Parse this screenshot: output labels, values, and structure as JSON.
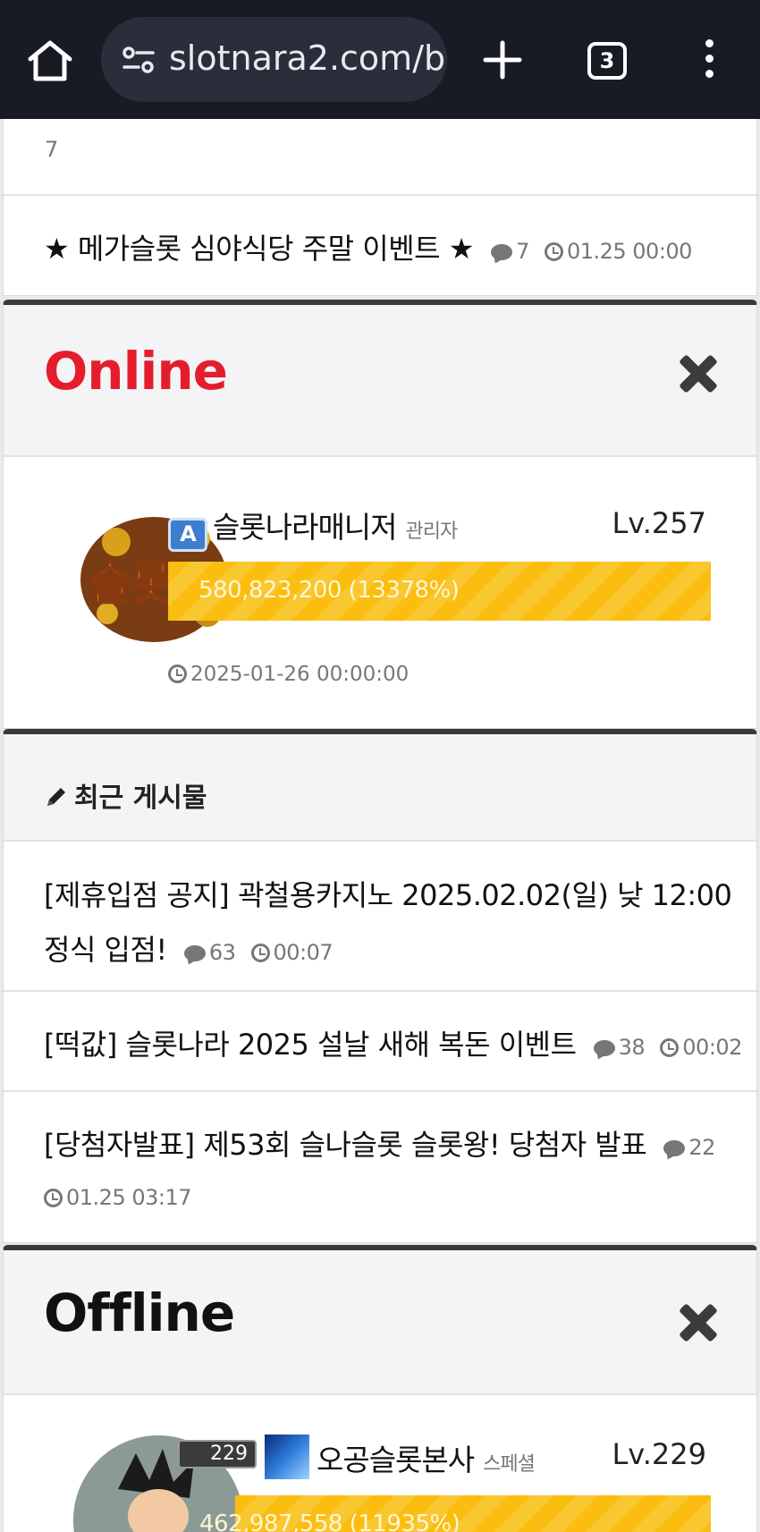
{
  "browser": {
    "url": "slotnara2.com/b",
    "tab_count": "3"
  },
  "top_list": {
    "partial_text": "7",
    "item": {
      "title": "★ 메가슬롯 심야식당 주말 이벤트 ★",
      "comments": "7",
      "time": "01.25 00:00"
    }
  },
  "online": {
    "title": "Online",
    "user": {
      "name": "슬롯나라매니저",
      "role": "관리자",
      "level": "Lv.257",
      "xp": "580,823,200 (13378%)",
      "last_login": "2025-01-26 00:00:00"
    }
  },
  "recent": {
    "heading": "최근 게시물",
    "posts": [
      {
        "title": "[제휴입점 공지] 곽철용카지노 2025.02.02(일) 낮 12:00",
        "title2": "정식 입점!",
        "comments": "63",
        "time": "00:07"
      },
      {
        "title": "[떡값] 슬롯나라 2025 설날 새해 복돈 이벤트",
        "comments": "38",
        "time": "00:02"
      },
      {
        "title": "[당첨자발표] 제53회 슬나슬롯 슬롯왕! 당첨자 발표",
        "comments": "22",
        "time": "01.25 03:17"
      }
    ]
  },
  "offline": {
    "title": "Offline",
    "user": {
      "badge_level": "229",
      "name": "오공슬롯본사",
      "role": "스페셜",
      "level": "Lv.229",
      "xp": "462,987,558 (11935%)"
    }
  },
  "colors": {
    "online_title": "#e41d2d",
    "xp_bar": "#fbbd0f",
    "browser_bar": "#181a24"
  }
}
